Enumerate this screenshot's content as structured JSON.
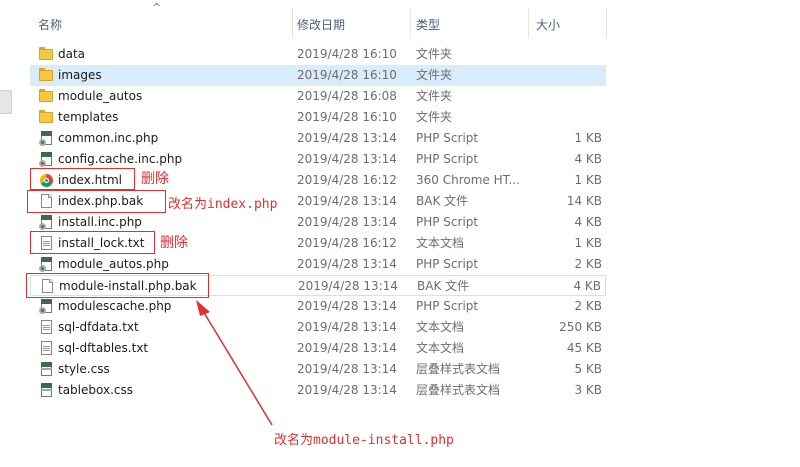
{
  "header": {
    "name": "名称",
    "date": "修改日期",
    "type": "类型",
    "size": "大小",
    "sort_arrow": "^"
  },
  "rows": [
    {
      "name": "data",
      "date": "2019/4/28 16:10",
      "type": "文件夹",
      "size": "",
      "icon": "folder-icon"
    },
    {
      "name": "images",
      "date": "2019/4/28 16:10",
      "type": "文件夹",
      "size": "",
      "icon": "folder-icon",
      "selected": true
    },
    {
      "name": "module_autos",
      "date": "2019/4/28 16:08",
      "type": "文件夹",
      "size": "",
      "icon": "folder-icon"
    },
    {
      "name": "templates",
      "date": "2019/4/28 16:10",
      "type": "文件夹",
      "size": "",
      "icon": "folder-icon"
    },
    {
      "name": "common.inc.php",
      "date": "2019/4/28 13:14",
      "type": "PHP Script",
      "size": "1 KB",
      "icon": "php-script-icon"
    },
    {
      "name": "config.cache.inc.php",
      "date": "2019/4/28 13:14",
      "type": "PHP Script",
      "size": "4 KB",
      "icon": "php-script-icon"
    },
    {
      "name": "index.html",
      "date": "2019/4/28 16:12",
      "type": "360 Chrome HT...",
      "size": "1 KB",
      "icon": "chrome-icon"
    },
    {
      "name": "index.php.bak",
      "date": "2019/4/28 13:14",
      "type": "BAK 文件",
      "size": "14 KB",
      "icon": "file-icon"
    },
    {
      "name": "install.inc.php",
      "date": "2019/4/28 13:14",
      "type": "PHP Script",
      "size": "4 KB",
      "icon": "php-script-icon"
    },
    {
      "name": "install_lock.txt",
      "date": "2019/4/28 16:12",
      "type": "文本文档",
      "size": "1 KB",
      "icon": "text-file-icon"
    },
    {
      "name": "module_autos.php",
      "date": "2019/4/28 13:14",
      "type": "PHP Script",
      "size": "2 KB",
      "icon": "php-script-icon"
    },
    {
      "name": "module-install.php.bak",
      "date": "2019/4/28 13:14",
      "type": "BAK 文件",
      "size": "4 KB",
      "icon": "file-icon",
      "framed": true
    },
    {
      "name": "modulescache.php",
      "date": "2019/4/28 13:14",
      "type": "PHP Script",
      "size": "2 KB",
      "icon": "php-script-icon"
    },
    {
      "name": "sql-dfdata.txt",
      "date": "2019/4/28 13:14",
      "type": "文本文档",
      "size": "250 KB",
      "icon": "text-file-icon"
    },
    {
      "name": "sql-dftables.txt",
      "date": "2019/4/28 13:14",
      "type": "文本文档",
      "size": "45 KB",
      "icon": "text-file-icon"
    },
    {
      "name": "style.css",
      "date": "2019/4/28 13:14",
      "type": "层叠样式表文档",
      "size": "5 KB",
      "icon": "css-file-icon"
    },
    {
      "name": "tablebox.css",
      "date": "2019/4/28 13:14",
      "type": "层叠样式表文档",
      "size": "3 KB",
      "icon": "css-file-icon"
    }
  ],
  "annotations": {
    "delete_1": "删除",
    "rename_index": "改名为index.php",
    "delete_2": "删除",
    "rename_module": "改名为module-install.php"
  },
  "colors": {
    "annotation": "#e03030",
    "selected_row": "#d9ecfb",
    "header_text": "#4c607a"
  }
}
